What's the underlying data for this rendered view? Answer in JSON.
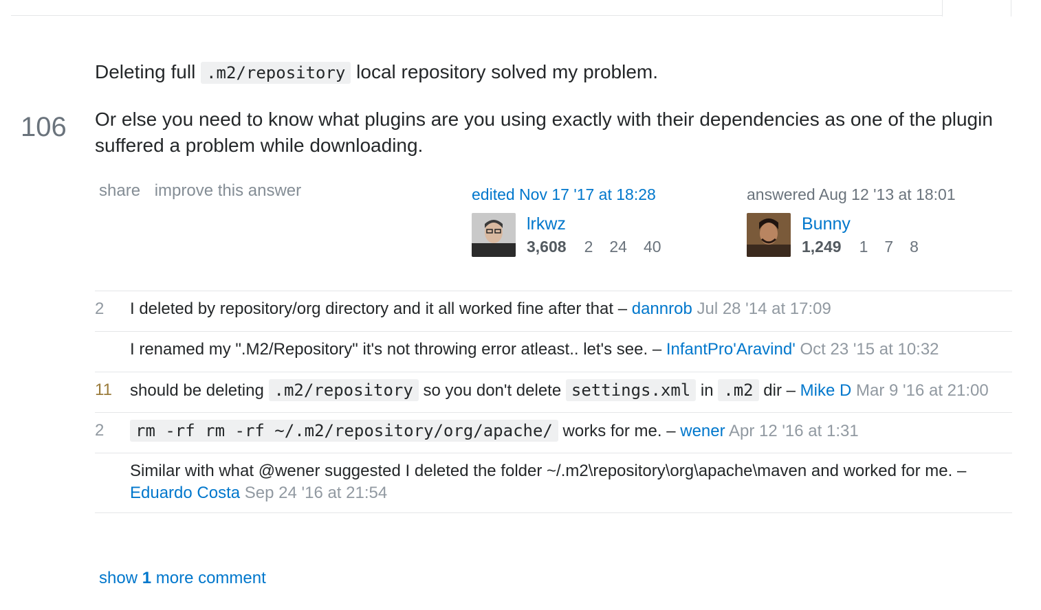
{
  "answer": {
    "votes": "106",
    "para1_before": "Deleting full ",
    "para1_code": ".m2/repository",
    "para1_after": " local repository solved my problem.",
    "para2": "Or else you need to know what plugins are you using exactly with their dependencies as one of the plugin suffered a problem while downloading."
  },
  "post_menu": {
    "share": "share",
    "improve": "improve this answer"
  },
  "editor": {
    "action": "edited Nov 17 '17 at 18:28",
    "name": "lrkwz",
    "rep": "3,608",
    "gold": "2",
    "silver": "24",
    "bronze": "40"
  },
  "author": {
    "action": "answered Aug 12 '13 at 18:01",
    "name": "Bunny",
    "rep": "1,249",
    "gold": "1",
    "silver": "7",
    "bronze": "8"
  },
  "comments": [
    {
      "score": "2",
      "text": "I deleted by repository/org directory and it all worked fine after that – ",
      "user": "dannrob",
      "date": "Jul 28 '14 at 17:09"
    },
    {
      "score": "",
      "text": "I renamed my \".M2/Repository\" it's not throwing error atleast.. let's see. – ",
      "user": "InfantPro'Aravind'",
      "date": "Oct 23 '15 at 10:32"
    },
    {
      "score": "11",
      "t1": "should be deleting ",
      "c1": ".m2/repository",
      "t2": " so you don't delete ",
      "c2": "settings.xml",
      "t3": " in ",
      "c3": ".m2",
      "t4": " dir – ",
      "user": "Mike D",
      "date": "Mar 9 '16 at 21:00"
    },
    {
      "score": "2",
      "code": "rm -rf rm -rf ~/.m2/repository/org/apache/",
      "text": " works for me. – ",
      "user": "wener",
      "date": "Apr 12 '16 at 1:31"
    },
    {
      "score": "",
      "text": "Similar with what @wener suggested I deleted the folder ~/.m2\\repository\\org\\apache\\maven and worked for me. – ",
      "user": "Eduardo Costa",
      "date": "Sep 24 '16 at 21:54"
    }
  ],
  "show_more": {
    "before": "show ",
    "count": "1",
    "after": " more comment"
  },
  "colors": {
    "link": "#0077cc",
    "muted": "#9199a1",
    "code_bg": "#eff0f1"
  }
}
